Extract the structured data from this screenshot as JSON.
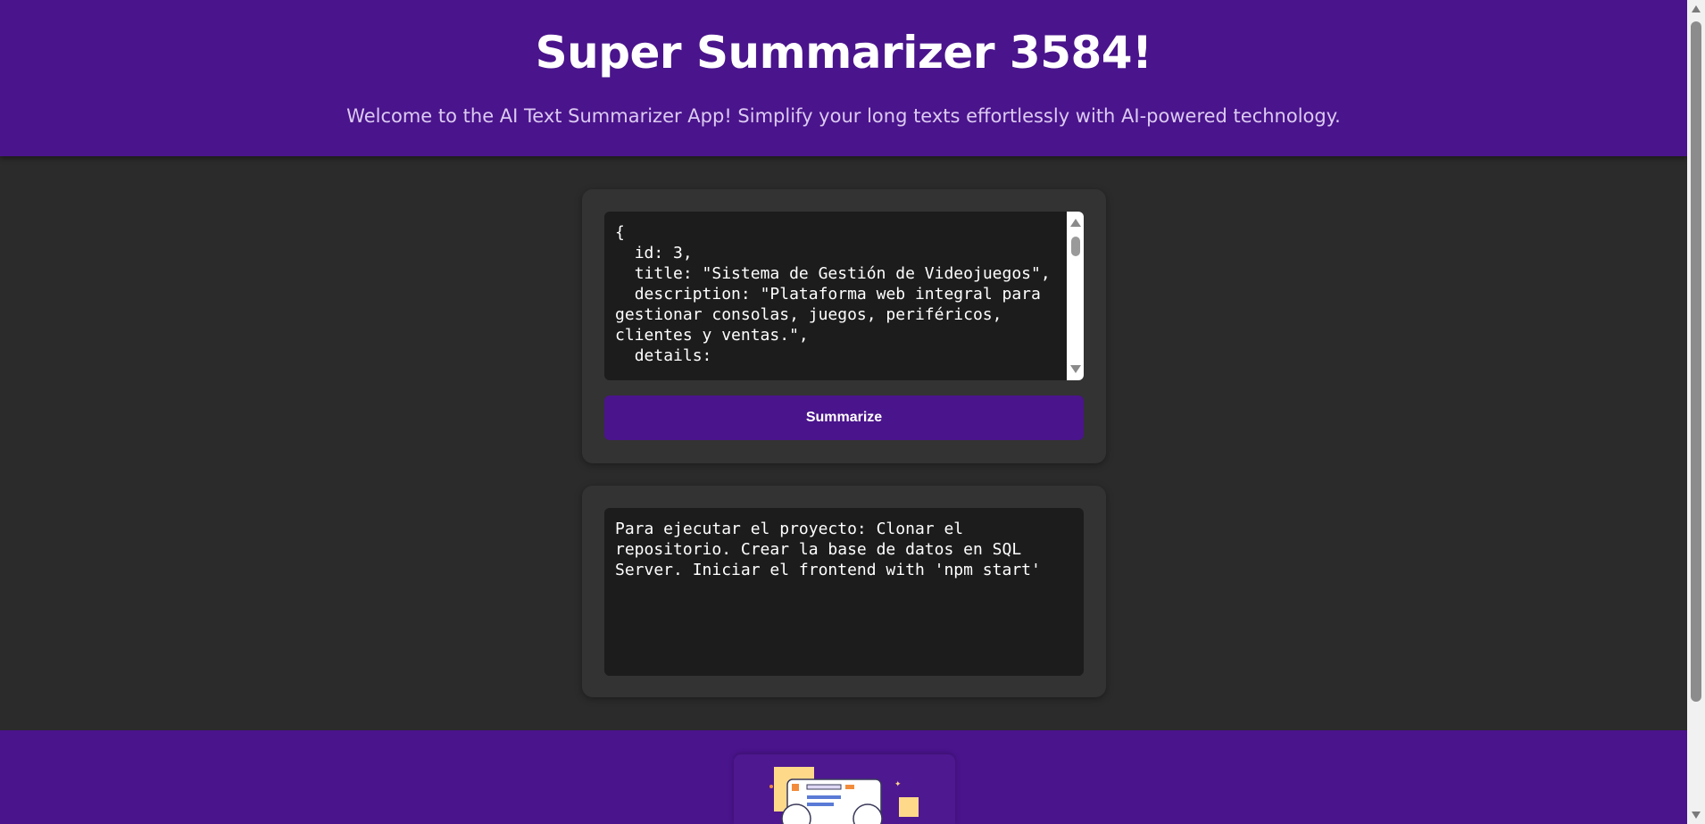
{
  "header": {
    "title": "Super Summarizer 3584!",
    "subtitle": "Welcome to the AI Text Summarizer App! Simplify your long texts effortlessly with AI-powered technology."
  },
  "input": {
    "text": "{\n  id: 3,\n  title: \"Sistema de Gestión de Videojuegos\",\n  description: \"Plataforma web integral para gestionar consolas, juegos, periféricos, clientes y ventas.\",\n  details:"
  },
  "summarize_button": {
    "label": "Summarize"
  },
  "output": {
    "text": "Para ejecutar el proyecto: Clonar el repositorio. Crear la base de datos en SQL Server. Iniciar el frontend with 'npm start'"
  },
  "footer": {
    "illustration_icon": "coding-illustration-icon"
  },
  "colors": {
    "brand": "#4a148c",
    "background": "#2b2b2b",
    "card": "#333333",
    "field": "#1c1c1c"
  }
}
